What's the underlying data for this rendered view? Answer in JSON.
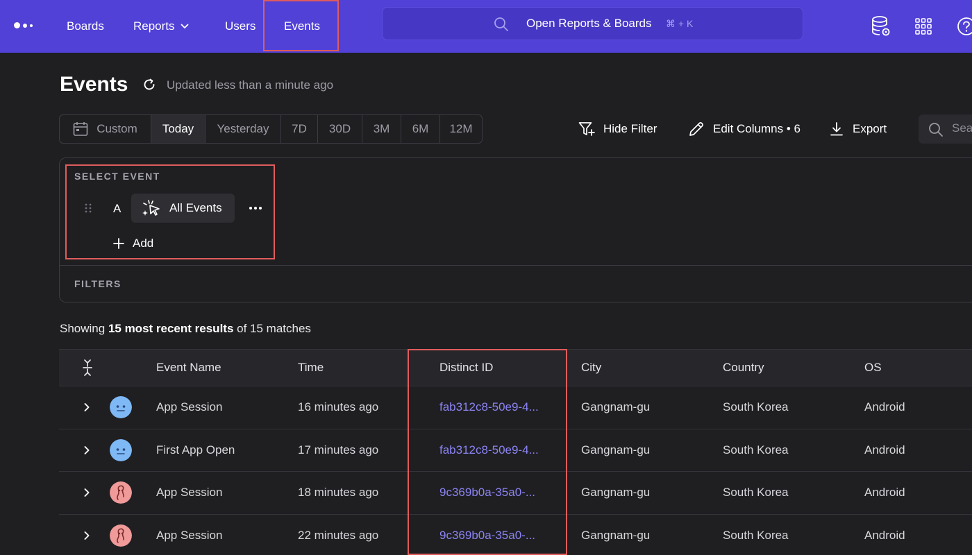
{
  "nav": {
    "items": [
      {
        "label": "Boards"
      },
      {
        "label": "Reports"
      },
      {
        "label": "Users"
      },
      {
        "label": "Events"
      }
    ],
    "active": "Events",
    "omnibar_text": "Open Reports & Boards",
    "omnibar_shortcut": "⌘ + K",
    "icons": [
      "database-settings-icon",
      "apps-grid-icon",
      "help-icon"
    ]
  },
  "page": {
    "title": "Events",
    "updated": "Updated less than a minute ago"
  },
  "range": {
    "options": [
      "Custom",
      "Today",
      "Yesterday",
      "7D",
      "30D",
      "3M",
      "6M",
      "12M"
    ],
    "selected": "Today"
  },
  "toolbar": {
    "hide_filter": "Hide Filter",
    "edit_columns": "Edit Columns • 6",
    "export": "Export",
    "search_placeholder": "Search"
  },
  "panel": {
    "select_event_label": "SELECT EVENT",
    "event_letter": "A",
    "event_name": "All Events",
    "add_label": "Add",
    "filters_label": "FILTERS"
  },
  "results": {
    "prefix": "Showing ",
    "bold": "15 most recent results",
    "suffix": " of 15 matches"
  },
  "table": {
    "columns": [
      "Event Name",
      "Time",
      "Distinct ID",
      "City",
      "Country",
      "OS"
    ],
    "rows": [
      {
        "avatar": "blue",
        "event": "App Session",
        "time": "16 minutes ago",
        "distinct_id": "fab312c8-50e9-4...",
        "city": "Gangnam-gu",
        "country": "South Korea",
        "os": "Android"
      },
      {
        "avatar": "blue",
        "event": "First App Open",
        "time": "17 minutes ago",
        "distinct_id": "fab312c8-50e9-4...",
        "city": "Gangnam-gu",
        "country": "South Korea",
        "os": "Android"
      },
      {
        "avatar": "pink",
        "event": "App Session",
        "time": "18 minutes ago",
        "distinct_id": "9c369b0a-35a0-...",
        "city": "Gangnam-gu",
        "country": "South Korea",
        "os": "Android"
      },
      {
        "avatar": "pink",
        "event": "App Session",
        "time": "22 minutes ago",
        "distinct_id": "9c369b0a-35a0-...",
        "city": "Gangnam-gu",
        "country": "South Korea",
        "os": "Android"
      }
    ]
  },
  "colors": {
    "nav_bg": "#5141d6",
    "page_bg": "#1f1f22",
    "link": "#8c84f2",
    "highlight": "#e05c5c",
    "avatar_blue": "#7eb8f5",
    "avatar_pink": "#f09a9a"
  }
}
